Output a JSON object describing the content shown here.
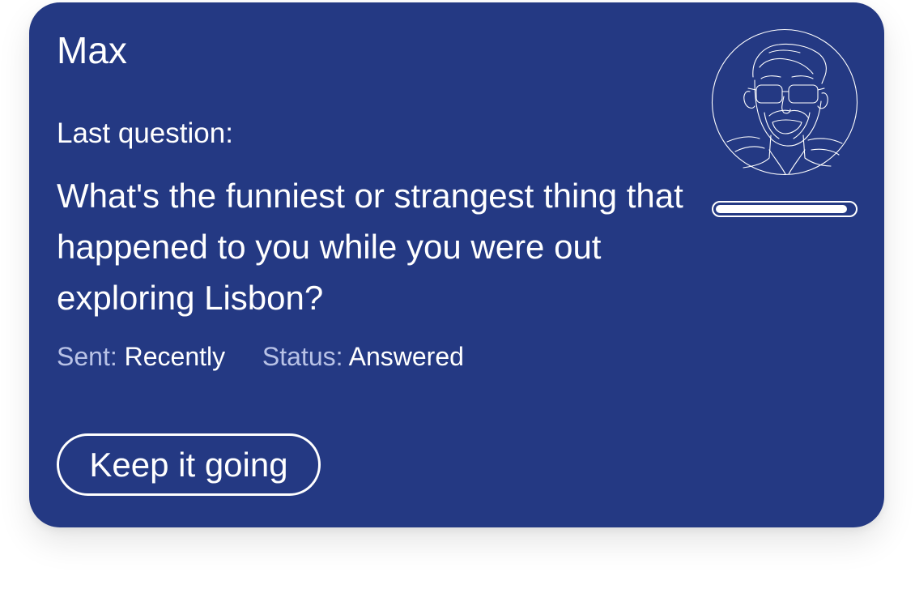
{
  "colors": {
    "card_background": "#243983",
    "text": "#ffffff",
    "meta_key": "#b8c2e6"
  },
  "card": {
    "name": "Max",
    "last_question_label": "Last question:",
    "question": "What's the funniest or strangest thing that happened to you while you were out exploring Lisbon?",
    "meta": {
      "sent_key": "Sent:",
      "sent_value": "Recently",
      "status_key": "Status:",
      "status_value": "Answered"
    },
    "cta_label": "Keep it going",
    "avatar_icon": "bearded-man-with-glasses-line-portrait",
    "progress": 0.95
  }
}
